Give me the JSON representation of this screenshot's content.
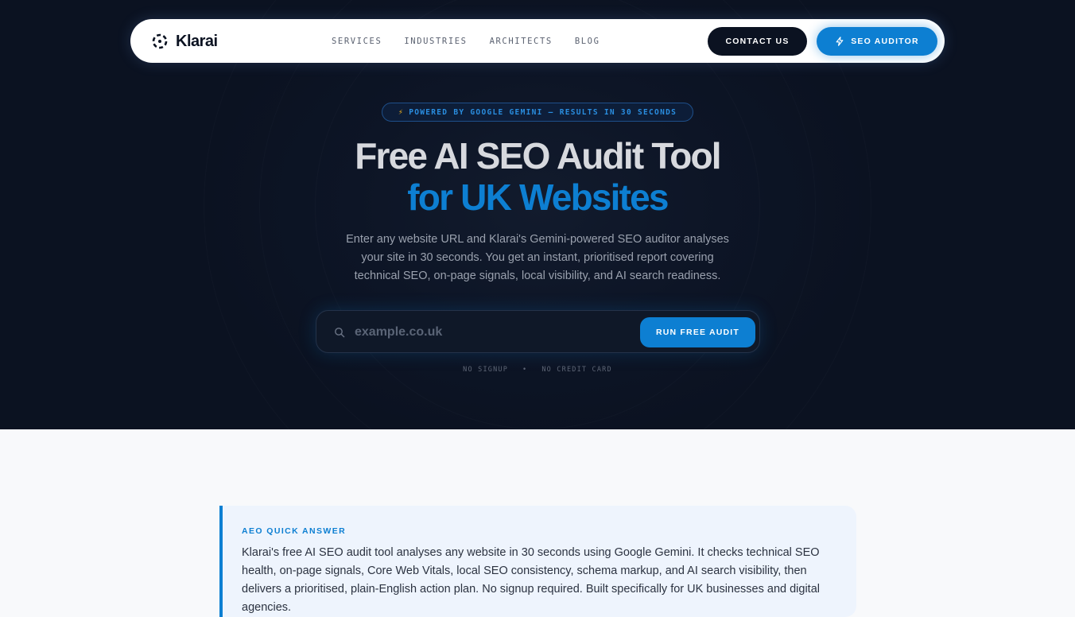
{
  "nav": {
    "logo_text": "Klarai",
    "links": [
      "SERVICES",
      "INDUSTRIES",
      "ARCHITECTS",
      "BLOG"
    ],
    "contact_label": "CONTACT US",
    "auditor_label": "SEO AUDITOR"
  },
  "hero": {
    "badge": "POWERED BY GOOGLE GEMINI — RESULTS IN 30 SECONDS",
    "title_line1": "Free AI SEO Audit Tool",
    "title_line2": "for UK Websites",
    "subtitle": "Enter any website URL and Klarai's Gemini-powered SEO auditor analyses your site in 30 seconds. You get an instant, prioritised report covering technical SEO, on-page signals, local visibility, and AI search readiness.",
    "search": {
      "placeholder": "example.co.uk",
      "value": "",
      "button_label": "RUN FREE AUDIT"
    },
    "notes": [
      "NO SIGNUP",
      "NO CREDIT CARD"
    ]
  },
  "aeo": {
    "label": "AEO QUICK ANSWER",
    "text": "Klarai's free AI SEO audit tool analyses any website in 30 seconds using Google Gemini. It checks technical SEO health, on-page signals, Core Web Vitals, local SEO consistency, schema markup, and AI search visibility, then delivers a prioritised, plain-English action plan. No signup required. Built specifically for UK businesses and digital agencies."
  },
  "colors": {
    "hero_bg": "#0b1221",
    "accent": "#0d7fd2",
    "badge_bolt": "#f2b21b",
    "page_bg": "#f8f9fb",
    "card_bg": "#eef4fd"
  },
  "icons": {
    "logo": "klarai-logo-icon",
    "auditor": "lightning-icon",
    "search": "search-icon"
  }
}
